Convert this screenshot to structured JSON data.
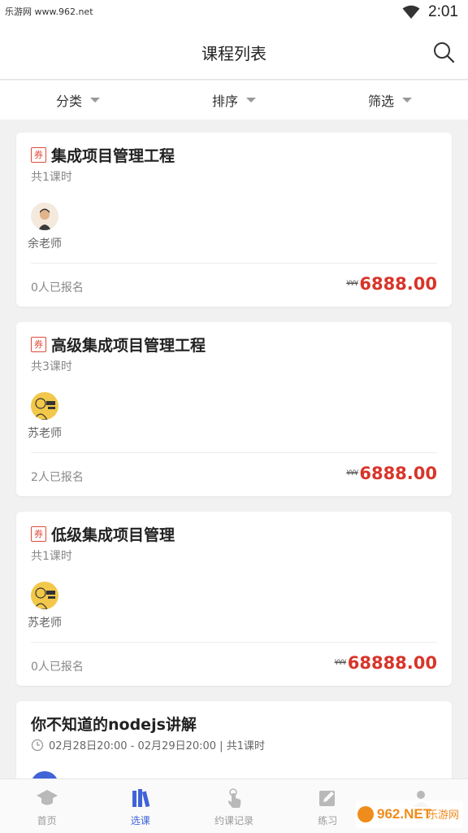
{
  "status_bar": {
    "watermark_text": "乐游网 www.962.net",
    "time": "2:01"
  },
  "header": {
    "title": "课程列表",
    "search_icon": "search-icon"
  },
  "filters": [
    {
      "label": "分类"
    },
    {
      "label": "排序"
    },
    {
      "label": "筛选"
    }
  ],
  "courses": [
    {
      "badge": "券",
      "title": "集成项目管理工程",
      "lessons": "共1课时",
      "teacher": "余老师",
      "enrolled": "0人已报名",
      "price_symbol": "¥¥¥",
      "price": "6888.00"
    },
    {
      "badge": "券",
      "title": "高级集成项目管理工程",
      "lessons": "共3课时",
      "teacher": "苏老师",
      "enrolled": "2人已报名",
      "price_symbol": "¥¥¥",
      "price": "6888.00"
    },
    {
      "badge": "券",
      "title": "低级集成项目管理",
      "lessons": "共1课时",
      "teacher": "苏老师",
      "enrolled": "0人已报名",
      "price_symbol": "¥¥¥",
      "price": "68888.00"
    },
    {
      "title": "你不知道的nodejs讲解",
      "schedule": "02月28日20:00 - 02月29日20:00 | 共1课时"
    }
  ],
  "tabs": [
    {
      "label": "首页",
      "icon": "graduation-cap-icon"
    },
    {
      "label": "选课",
      "icon": "books-icon"
    },
    {
      "label": "约课记录",
      "icon": "hand-pointer-icon"
    },
    {
      "label": "练习",
      "icon": "pencil-square-icon"
    },
    {
      "label": "",
      "icon": "profile-icon"
    }
  ],
  "colors": {
    "accent": "#3f63d8",
    "price": "#d8352a",
    "coupon": "#e04b3b"
  },
  "watermark_logo": {
    "main": "962.NET",
    "sub": "乐游网"
  }
}
